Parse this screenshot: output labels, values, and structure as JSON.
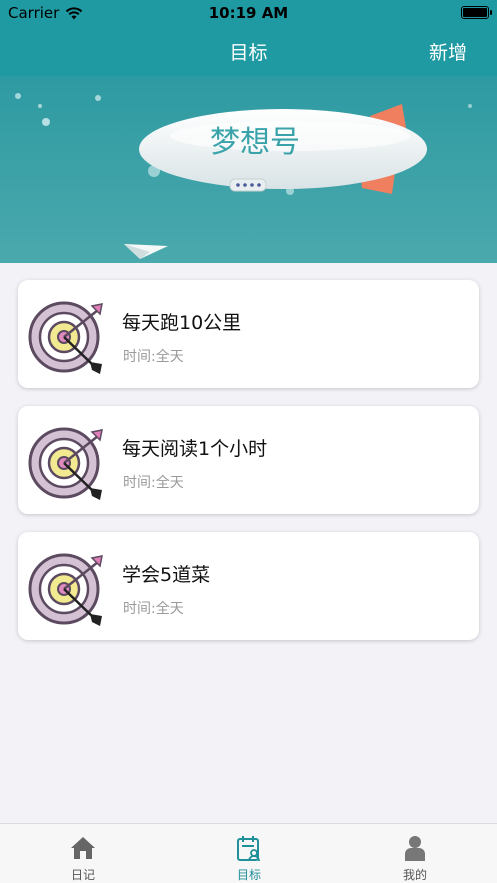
{
  "status": {
    "carrier": "Carrier",
    "time": "10:19 AM"
  },
  "nav": {
    "title": "目标",
    "add_label": "新增"
  },
  "banner": {
    "airship_text": "梦想号"
  },
  "goals": [
    {
      "title": "每天跑10公里",
      "time": "时间:全天"
    },
    {
      "title": "每天阅读1个小时",
      "time": "时间:全天"
    },
    {
      "title": "学会5道菜",
      "time": "时间:全天"
    }
  ],
  "tabs": [
    {
      "label": "日记",
      "icon": "house-icon"
    },
    {
      "label": "目标",
      "icon": "calendar-person-icon",
      "active": true
    },
    {
      "label": "我的",
      "icon": "person-icon"
    }
  ],
  "colors": {
    "accent": "#1f9aa3",
    "tab_active": "#1f8f99"
  }
}
